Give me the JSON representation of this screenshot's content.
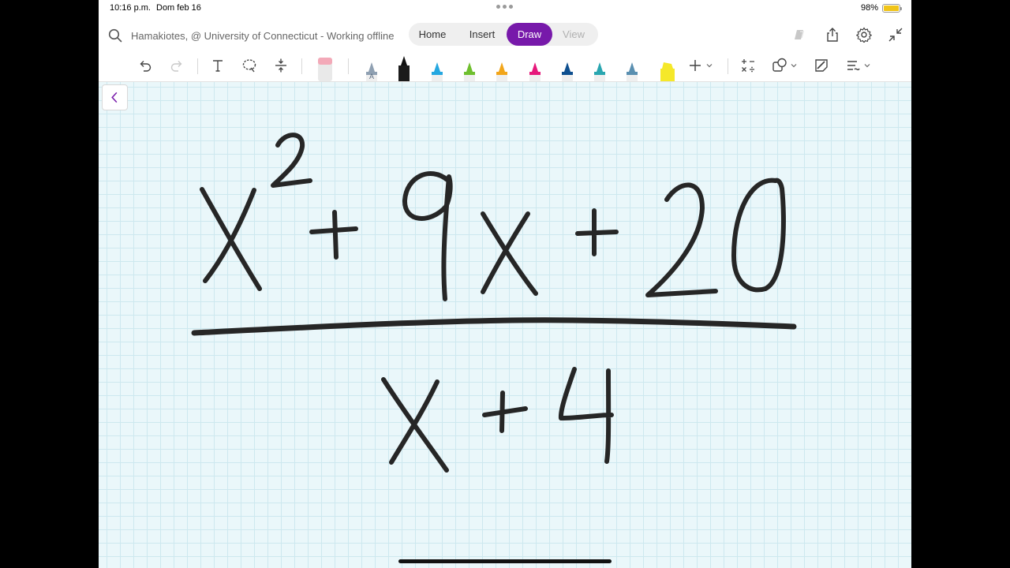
{
  "status": {
    "time": "10:16 p.m.",
    "date": "Dom feb 16",
    "battery_pct": "98%",
    "battery_level": 0.98
  },
  "header": {
    "notebook_title": "Hamakiotes, @ University of Connecticut - Working offline",
    "tabs": [
      {
        "label": "Home"
      },
      {
        "label": "Insert"
      },
      {
        "label": "Draw",
        "active": true
      },
      {
        "label": "View"
      }
    ],
    "icons": [
      "copilot-icon",
      "share-icon",
      "settings-icon",
      "collapse-icon"
    ]
  },
  "toolbar": {
    "tools": [
      "undo-icon",
      "redo-icon",
      "text-icon",
      "lasso-icon",
      "add-space-icon",
      "eraser-icon"
    ],
    "pens": [
      {
        "name": "pencil",
        "color": "#8fa0b2"
      },
      {
        "name": "black-pen",
        "color": "#111111"
      },
      {
        "name": "light-blue-pen",
        "color": "#25a7e0"
      },
      {
        "name": "green-pen",
        "color": "#6fbf2e"
      },
      {
        "name": "orange-pen",
        "color": "#f2a51a"
      },
      {
        "name": "magenta-pen",
        "color": "#e6177a"
      },
      {
        "name": "dark-blue-pen",
        "color": "#0e4f8f"
      },
      {
        "name": "teal-pen",
        "color": "#2aa6b0"
      },
      {
        "name": "gray-blue-pen",
        "color": "#5a8fb0"
      },
      {
        "name": "yellow-highlighter",
        "color": "#f5e82a"
      }
    ],
    "right_tools": [
      "add-pen-icon",
      "math-icon",
      "shapes-icon",
      "ink-to-shape-icon",
      "ink-to-text-icon"
    ]
  },
  "colors": {
    "accent": "#7719aa",
    "ink": "#262626",
    "grid_bg": "#eaf7fa",
    "grid_line": "#cde8ef"
  }
}
